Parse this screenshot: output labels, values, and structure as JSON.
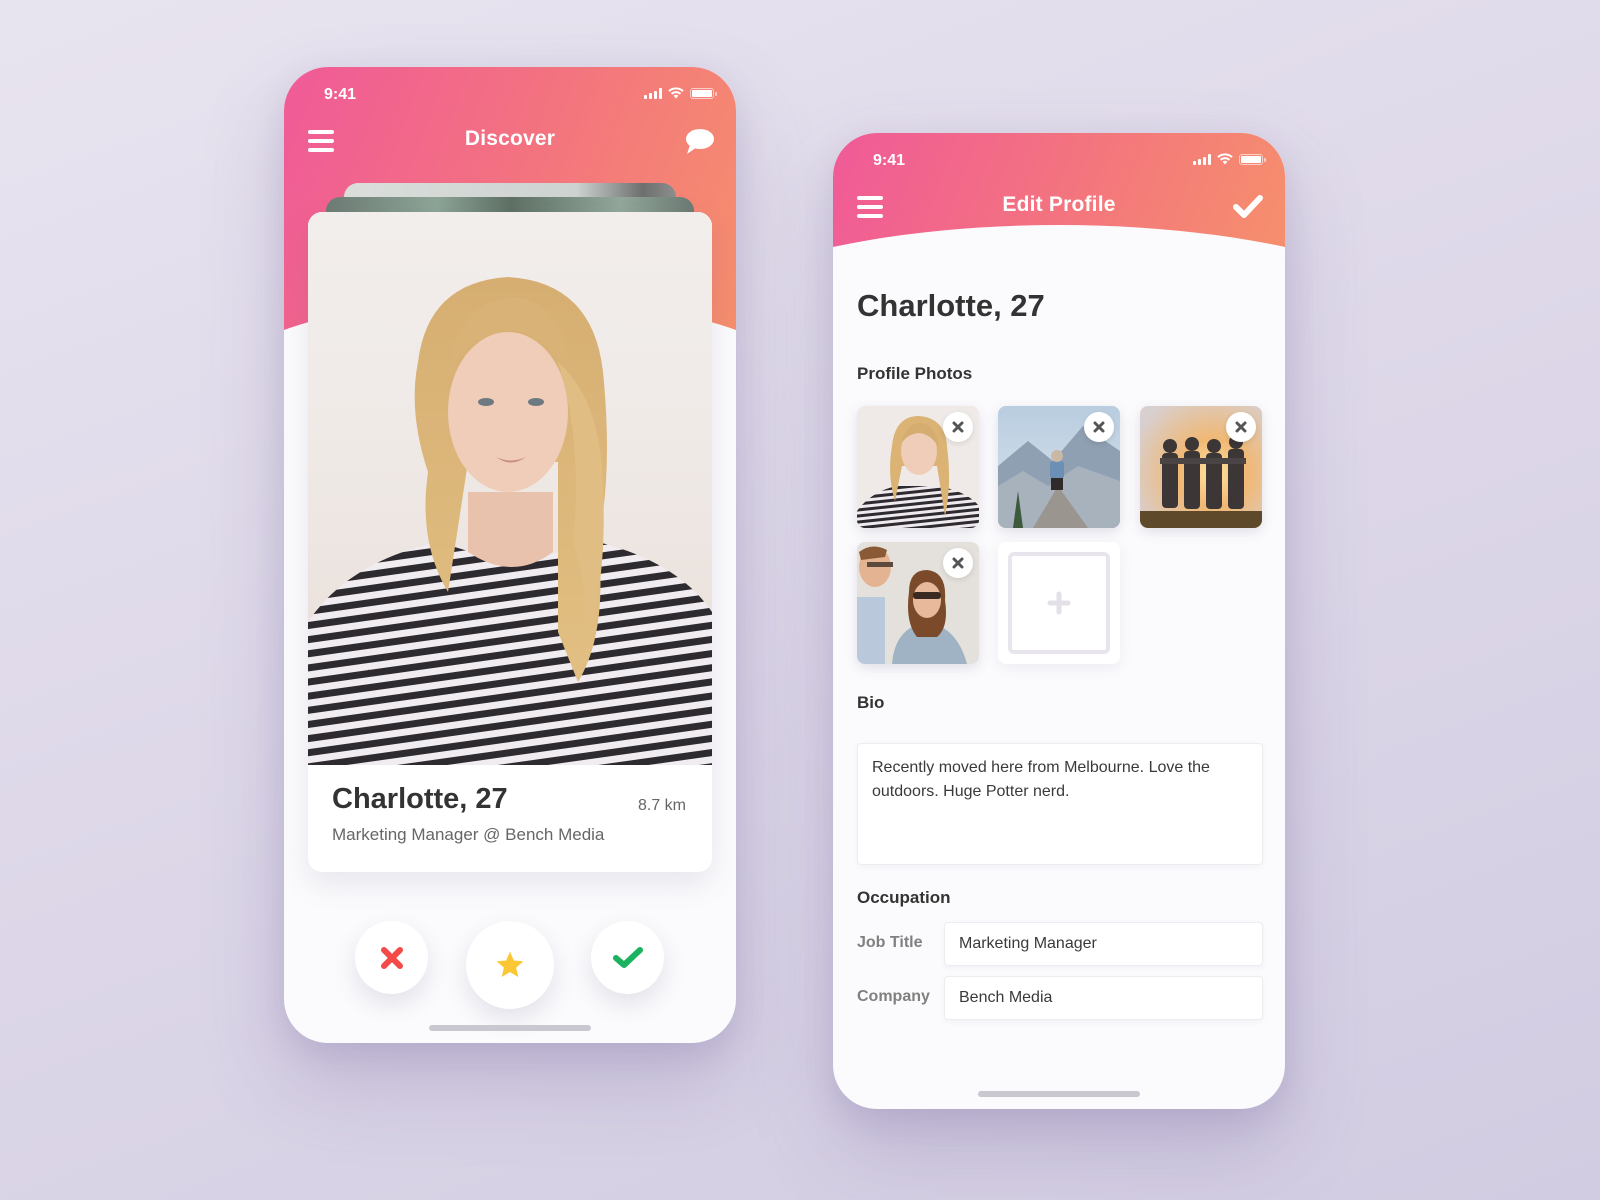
{
  "colors": {
    "header_gradient_start": "#f05a98",
    "header_gradient_end": "#f6906c",
    "nope": "#f44a4a",
    "super_like": "#fcc734",
    "like": "#1bb35f",
    "background": "#e2dcea"
  },
  "discover": {
    "status_bar": {
      "time": "9:41"
    },
    "nav": {
      "menu_icon": "hamburger-icon",
      "title": "Discover",
      "right_icon": "chat-bubble-icon"
    },
    "card": {
      "photo": "woman-striped-shirt-portrait",
      "name": "Charlotte, 27",
      "distance": "8.7 km",
      "subtitle": "Marketing Manager @ Bench Media"
    },
    "actions": [
      {
        "name": "nope",
        "icon": "close-icon"
      },
      {
        "name": "super-like",
        "icon": "star-icon"
      },
      {
        "name": "like",
        "icon": "check-icon"
      }
    ]
  },
  "edit_profile": {
    "status_bar": {
      "time": "9:41"
    },
    "nav": {
      "menu_icon": "hamburger-icon",
      "title": "Edit Profile",
      "right_icon": "check-icon"
    },
    "name": "Charlotte, 27",
    "photos_label": "Profile Photos",
    "photos": [
      {
        "subject": "woman-striped-shirt-portrait",
        "remove_icon": "close-icon"
      },
      {
        "subject": "person-sitting-on-mountain-rock",
        "remove_icon": "close-icon"
      },
      {
        "subject": "group-of-friends-at-sunset",
        "remove_icon": "close-icon"
      },
      {
        "subject": "couple-smiling-outdoors",
        "remove_icon": "close-icon"
      }
    ],
    "add_photo_icon": "plus-icon",
    "bio_label": "Bio",
    "bio": "Recently moved here from Melbourne. Love the outdoors. Huge Potter nerd.",
    "occupation_label": "Occupation",
    "job_title_label": "Job Title",
    "job_title": "Marketing Manager",
    "company_label": "Company",
    "company": "Bench Media"
  }
}
